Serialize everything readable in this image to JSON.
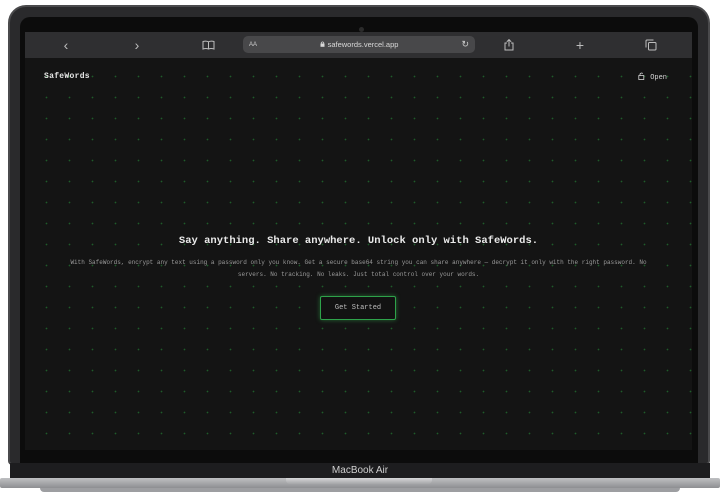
{
  "browser": {
    "back_icon": "‹",
    "forward_icon": "›",
    "aa_label": "AA",
    "url": "safewords.vercel.app",
    "reload_icon": "↻",
    "share_icon": "⇪",
    "new_tab_icon": "+",
    "tabs_icon": "⧉"
  },
  "site": {
    "logo": "SafeWords",
    "open_label": "Open",
    "headline": "Say anything. Share anywhere. Unlock only with SafeWords.",
    "subtext": "With SafeWords, encrypt any text using a password only you know. Get a secure base64 string you can share anywhere — decrypt it only with the right password. No servers. No tracking. No leaks. Just total control over your words.",
    "cta_label": "Get Started",
    "accent_color": "#2ea24a"
  },
  "device": {
    "model_label": "MacBook Air"
  }
}
